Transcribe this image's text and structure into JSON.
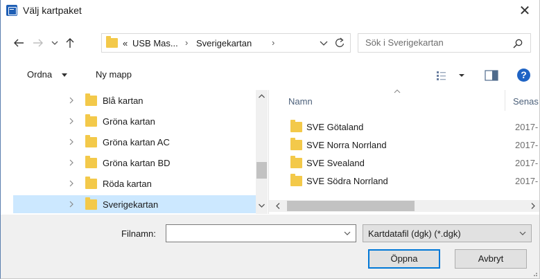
{
  "window": {
    "title": "Välj kartpaket",
    "close_glyph": "✕",
    "accent_color": "#0078d7",
    "selection_color": "#cce8ff",
    "folder_color": "#f3c94a"
  },
  "address_bar": {
    "overflow": "«",
    "segments": [
      "USB Mas...",
      "Sverigekartan"
    ],
    "separator": "›",
    "search_placeholder": "Sök i Sverigekartan"
  },
  "toolbar": {
    "organize_label": "Ordna",
    "new_folder_label": "Ny mapp",
    "help_label": "?"
  },
  "nav_tree": {
    "items": [
      {
        "label": "Blå kartan",
        "selected": false
      },
      {
        "label": "Gröna kartan",
        "selected": false
      },
      {
        "label": "Gröna kartan AC",
        "selected": false
      },
      {
        "label": "Gröna kartan BD",
        "selected": false
      },
      {
        "label": "Röda kartan",
        "selected": false
      },
      {
        "label": "Sverigekartan",
        "selected": true
      }
    ]
  },
  "file_list": {
    "columns": {
      "name": "Namn",
      "date": "Senas"
    },
    "rows": [
      {
        "name": "SVE Götaland",
        "date": "2017-"
      },
      {
        "name": "SVE Norra Norrland",
        "date": "2017-"
      },
      {
        "name": "SVE Svealand",
        "date": "2017-"
      },
      {
        "name": "SVE Södra Norrland",
        "date": "2017-"
      }
    ]
  },
  "bottom": {
    "filename_label": "Filnamn:",
    "filename_value": "",
    "filetype_value": "Kartdatafil (dgk) (*.dgk)",
    "open_label": "Öppna",
    "cancel_label": "Avbryt"
  }
}
